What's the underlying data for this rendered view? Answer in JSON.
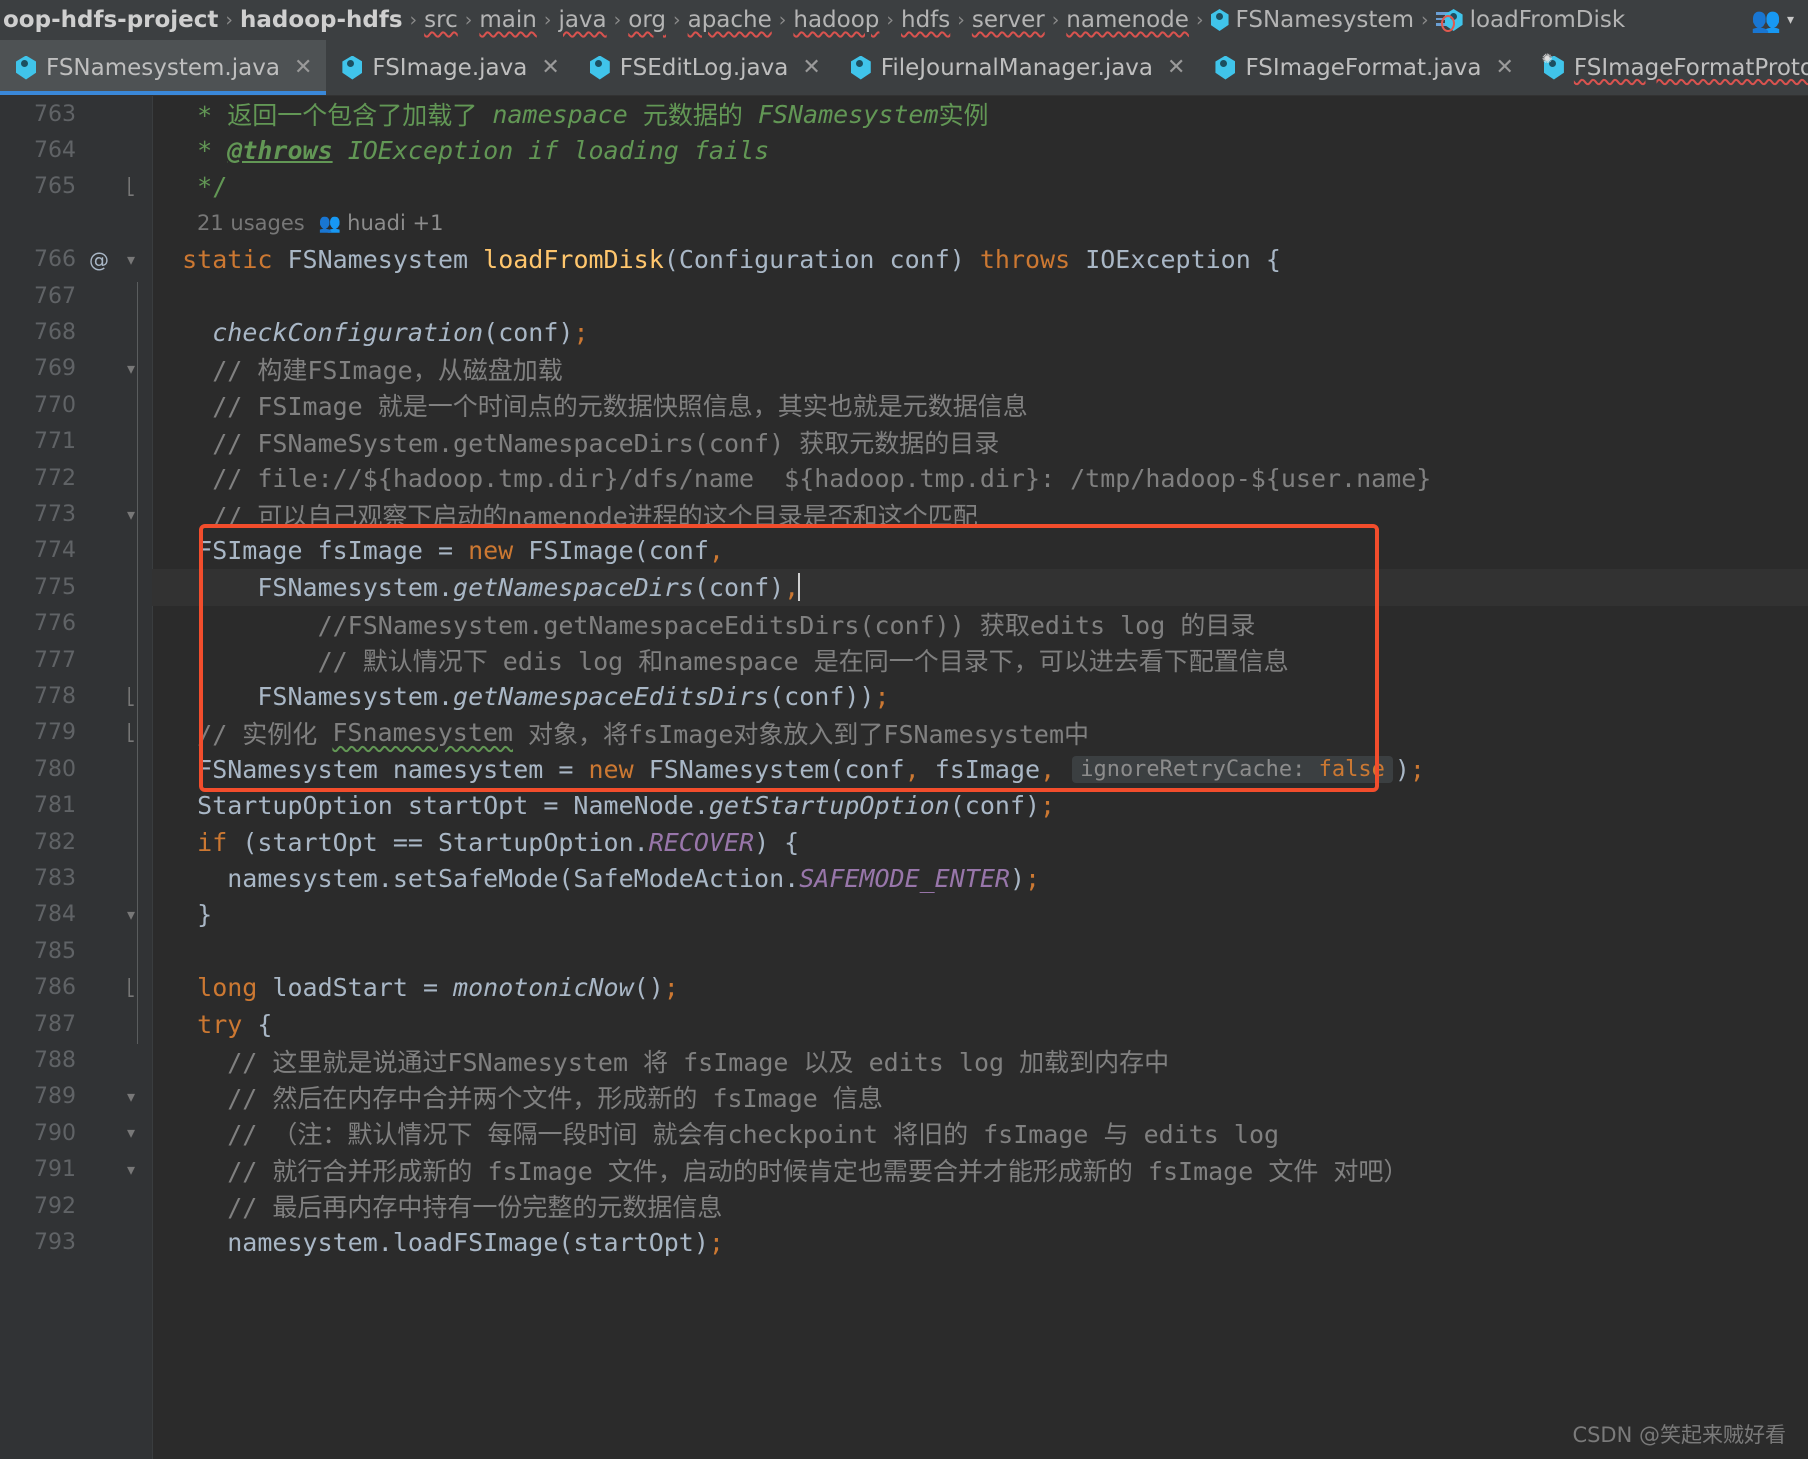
{
  "breadcrumb": {
    "items": [
      {
        "label": "oop-hdfs-project",
        "bold": true,
        "squiggly": false,
        "icon": null
      },
      {
        "label": "hadoop-hdfs",
        "bold": true,
        "squiggly": false,
        "icon": null
      },
      {
        "label": "src",
        "bold": false,
        "squiggly": true,
        "icon": null
      },
      {
        "label": "main",
        "bold": false,
        "squiggly": true,
        "icon": null
      },
      {
        "label": "java",
        "bold": false,
        "squiggly": true,
        "icon": null
      },
      {
        "label": "org",
        "bold": false,
        "squiggly": true,
        "icon": null
      },
      {
        "label": "apache",
        "bold": false,
        "squiggly": true,
        "icon": null
      },
      {
        "label": "hadoop",
        "bold": false,
        "squiggly": true,
        "icon": null
      },
      {
        "label": "hdfs",
        "bold": false,
        "squiggly": true,
        "icon": null
      },
      {
        "label": "server",
        "bold": false,
        "squiggly": true,
        "icon": null
      },
      {
        "label": "namenode",
        "bold": false,
        "squiggly": true,
        "icon": null
      },
      {
        "label": "FSNamesystem",
        "bold": false,
        "squiggly": false,
        "icon": "class-icon"
      },
      {
        "label": "loadFromDisk",
        "bold": false,
        "squiggly": false,
        "icon": "method-icon"
      }
    ],
    "separator": "›",
    "users_icon": "users-icon",
    "chevron": "▾"
  },
  "tabs": [
    {
      "label": "FSNamesystem.java",
      "active": true,
      "close": "✕",
      "icon": "java-class-icon",
      "squiggly": false
    },
    {
      "label": "FSImage.java",
      "active": false,
      "close": "✕",
      "icon": "java-class-icon",
      "squiggly": false
    },
    {
      "label": "FSEditLog.java",
      "active": false,
      "close": "✕",
      "icon": "java-class-icon",
      "squiggly": false
    },
    {
      "label": "FileJournalManager.java",
      "active": false,
      "close": "✕",
      "icon": "java-class-icon",
      "squiggly": false
    },
    {
      "label": "FSImageFormat.java",
      "active": false,
      "close": "✕",
      "icon": "java-class-icon",
      "squiggly": false
    },
    {
      "label": "FSImageFormatProtobuf.ja",
      "active": false,
      "close": "",
      "icon": "java-class-icon-modified",
      "squiggly": true
    }
  ],
  "editor": {
    "usages_badge": {
      "count_label": "21 usages",
      "author": "huadi +1",
      "author_icon": "people-icon"
    },
    "caret_line": 775,
    "inlay_hint": {
      "name": "ignoreRetryCache:",
      "value": "false"
    },
    "lines": [
      {
        "num": "763",
        "at": "",
        "fold": "",
        "text": " * 返回一个包含了加载了 namespace 元数据的 FSNamesystem实例"
      },
      {
        "num": "764",
        "at": "",
        "fold": "",
        "text": " * @throws IOException if loading fails"
      },
      {
        "num": "765",
        "at": "",
        "fold": "end",
        "text": " */"
      },
      {
        "num": "766",
        "at": "@",
        "fold": "start",
        "text": "static FSNamesystem loadFromDisk(Configuration conf) throws IOException {"
      },
      {
        "num": "767",
        "at": "",
        "fold": "",
        "text": ""
      },
      {
        "num": "768",
        "at": "",
        "fold": "",
        "text": "  checkConfiguration(conf);"
      },
      {
        "num": "769",
        "at": "",
        "fold": "start",
        "text": "  // 构建FSImage，从磁盘加载"
      },
      {
        "num": "770",
        "at": "",
        "fold": "",
        "text": "  // FSImage 就是一个时间点的元数据快照信息，其实也就是元数据信息"
      },
      {
        "num": "771",
        "at": "",
        "fold": "",
        "text": "  // FSNameSystem.getNamespaceDirs(conf) 获取元数据的目录"
      },
      {
        "num": "772",
        "at": "",
        "fold": "",
        "text": "  // file://${hadoop.tmp.dir}/dfs/name  ${hadoop.tmp.dir}: /tmp/hadoop-${user.name}"
      },
      {
        "num": "773",
        "at": "",
        "fold": "",
        "text": "  // 可以自己观察下启动的namenode进程的这个目录是否和这个匹配"
      },
      {
        "num": "774",
        "at": "",
        "fold": "",
        "text": "  FSImage fsImage = new FSImage(conf,"
      },
      {
        "num": "775",
        "at": "",
        "fold": "",
        "text": "      FSNamesystem.getNamespaceDirs(conf),"
      },
      {
        "num": "776",
        "at": "",
        "fold": "end",
        "text": "          //FSNamesystem.getNamespaceEditsDirs(conf)) 获取edits log 的目录"
      },
      {
        "num": "777",
        "at": "",
        "fold": "end",
        "text": "          // 默认情况下 edis log 和namespace 是在同一个目录下，可以进去看下配置信息"
      },
      {
        "num": "778",
        "at": "",
        "fold": "",
        "text": "      FSNamesystem.getNamespaceEditsDirs(conf));"
      },
      {
        "num": "779",
        "at": "",
        "fold": "",
        "text": "  // 实例化 FSnamesystem 对象，将fsImage对象放入到了FSNamesystem中"
      },
      {
        "num": "780",
        "at": "",
        "fold": "",
        "text": "  FSNamesystem namesystem = new FSNamesystem(conf, fsImage, ignoreRetryCache: false);"
      },
      {
        "num": "781",
        "at": "",
        "fold": "",
        "text": "  StartupOption startOpt = NameNode.getStartupOption(conf);"
      },
      {
        "num": "782",
        "at": "",
        "fold": "start",
        "text": "  if (startOpt == StartupOption.RECOVER) {"
      },
      {
        "num": "783",
        "at": "",
        "fold": "",
        "text": "    namesystem.setSafeMode(SafeModeAction.SAFEMODE_ENTER);"
      },
      {
        "num": "784",
        "at": "",
        "fold": "end",
        "text": "  }"
      },
      {
        "num": "785",
        "at": "",
        "fold": "",
        "text": ""
      },
      {
        "num": "786",
        "at": "",
        "fold": "",
        "text": "  long loadStart = monotonicNow();"
      },
      {
        "num": "787",
        "at": "",
        "fold": "start",
        "text": "  try {"
      },
      {
        "num": "788",
        "at": "",
        "fold": "start",
        "text": "    // 这里就是说通过FSNamesystem 将 fsImage 以及 edits log 加载到内存中"
      },
      {
        "num": "789",
        "at": "",
        "fold": "start",
        "text": "    // 然后在内存中合并两个文件，形成新的 fsImage 信息"
      },
      {
        "num": "790",
        "at": "",
        "fold": "",
        "text": "    // （注：默认情况下 每隔一段时间 就会有checkpoint 将旧的 fsImage 与 edits log"
      },
      {
        "num": "791",
        "at": "",
        "fold": "",
        "text": "    // 就行合并形成新的 fsImage 文件，启动的时候肯定也需要合并才能形成新的 fsImage 文件 对吧）"
      },
      {
        "num": "792",
        "at": "",
        "fold": "",
        "text": "    // 最后再内存中持有一份完整的元数据信息"
      },
      {
        "num": "793",
        "at": "",
        "fold": "",
        "text": "    namesystem.loadFSImage(startOpt);"
      }
    ]
  },
  "watermark": "CSDN @笑起来贼好看",
  "colors": {
    "accent_blue": "#3a88d9",
    "highlight_red": "#f24d2c",
    "icon_cyan": "#40c4ea",
    "keyword_orange": "#cc7832",
    "method_yellow": "#ffc66d",
    "comment_gray": "#808080",
    "doc_green": "#629755"
  }
}
